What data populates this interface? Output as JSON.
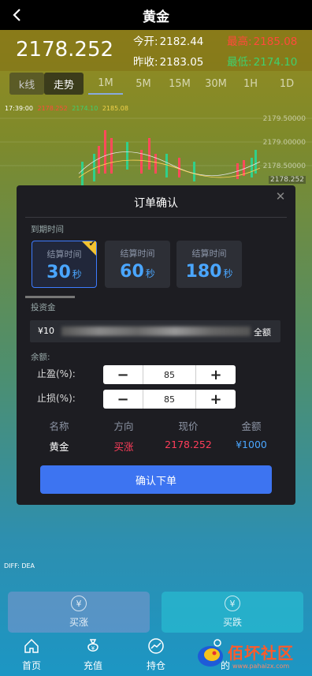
{
  "header": {
    "title": "黄金"
  },
  "ticker": {
    "price": "2178.252",
    "open_label": "今开:",
    "open_value": "2182.44",
    "high_label": "最高:",
    "high_value": "2185.08",
    "prev_close_label": "昨收:",
    "prev_close_value": "2183.05",
    "low_label": "最低:",
    "low_value": "2174.10"
  },
  "tabs": [
    "k线",
    "走势",
    "1M",
    "5M",
    "15M",
    "30M",
    "1H",
    "1D"
  ],
  "chart_info": {
    "time": "17:39:00",
    "v1": "2178.252",
    "v2": "2174.10",
    "v3": "2185.08"
  },
  "chart_axis": [
    "2179.50000",
    "2179.00000",
    "2178.50000",
    "2178.252"
  ],
  "modal": {
    "title": "订单确认",
    "expiry_label": "到期时间",
    "options": [
      {
        "label": "结算时间",
        "value": "30",
        "unit": "秒",
        "selected": true
      },
      {
        "label": "结算时间",
        "value": "60",
        "unit": "秒",
        "selected": false
      },
      {
        "label": "结算时间",
        "value": "180",
        "unit": "秒",
        "selected": false
      }
    ],
    "amount_label": "投资金",
    "amount_prefix": "¥10",
    "all_button": "全额",
    "balance_label": "余额:",
    "take_profit_label": "止盈(%):",
    "take_profit_value": "85",
    "stop_loss_label": "止损(%):",
    "stop_loss_value": "85",
    "table_headers": [
      "名称",
      "方向",
      "现价",
      "金额"
    ],
    "row": {
      "name": "黄金",
      "direction": "买涨",
      "price": "2178.252",
      "amount": "¥1000"
    },
    "confirm_label": "确认下单"
  },
  "diff_label": "DIFF: DEA",
  "trade_buttons": {
    "buy_up": "买涨",
    "buy_down": "买跌"
  },
  "nav": [
    "首页",
    "充值",
    "持仓",
    "的"
  ],
  "watermark": {
    "text": "佰坏社区",
    "sub": "www.pahaizx.com"
  },
  "colors": {
    "up": "#ff3d5a",
    "down": "#30d08a",
    "accent": "#3d74f1",
    "highlight": "#f2c230"
  }
}
